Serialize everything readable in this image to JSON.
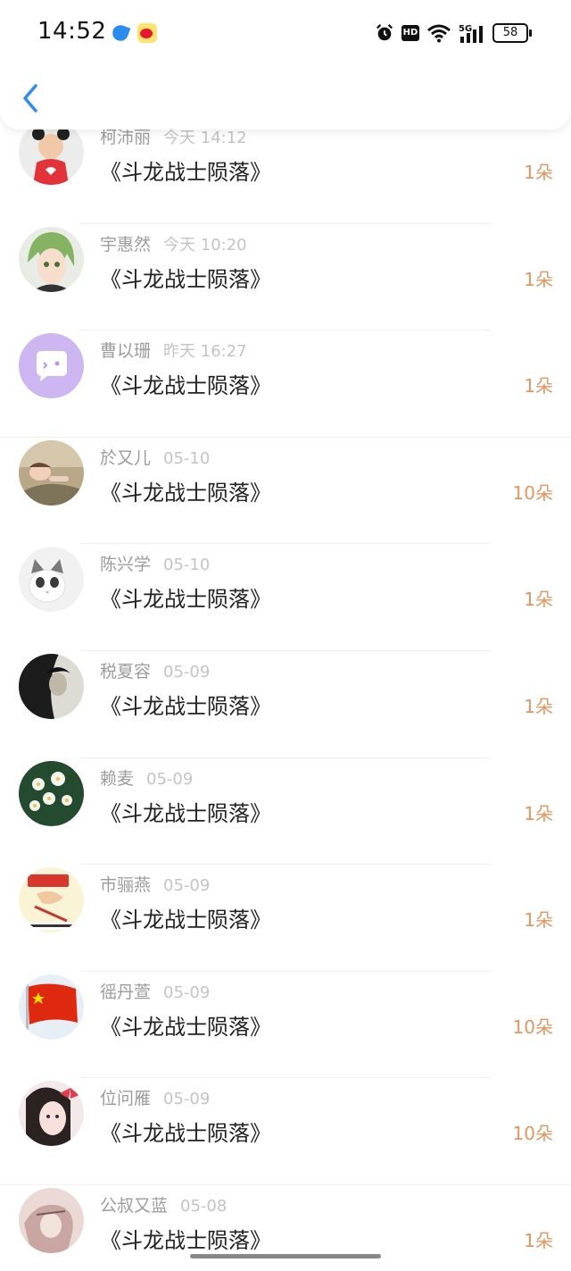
{
  "status_bar": {
    "time": "14:52",
    "battery": "58",
    "hd": "HD",
    "network": "5G"
  },
  "header": {
    "back_icon": "chevron-left-icon",
    "accent": "#2f8fe6"
  },
  "colors": {
    "name": "#9c9c9c",
    "date": "#c4c4c4",
    "title": "#222222",
    "count": "#e8945e"
  },
  "gifts": [
    {
      "name": "柯沛丽",
      "date": "今天 14:12",
      "title": "《斗龙战士陨落》",
      "count": "1朵",
      "avatar": "girl-red-avatar"
    },
    {
      "name": "宇惠然",
      "date": "今天 10:20",
      "title": "《斗龙战士陨落》",
      "count": "1朵",
      "avatar": "anime-boy-avatar"
    },
    {
      "name": "曹以珊",
      "date": "昨天 16:27",
      "title": "《斗龙战士陨落》",
      "count": "1朵",
      "avatar": "chat-bubble-avatar"
    },
    {
      "name": "於又儿",
      "date": "05-10",
      "title": "《斗龙战士陨落》",
      "count": "10朵",
      "avatar": "outdoor-girl-avatar"
    },
    {
      "name": "陈兴学",
      "date": "05-10",
      "title": "《斗龙战士陨落》",
      "count": "1朵",
      "avatar": "cat-avatar"
    },
    {
      "name": "税夏容",
      "date": "05-09",
      "title": "《斗龙战士陨落》",
      "count": "1朵",
      "avatar": "dark-portrait-avatar"
    },
    {
      "name": "赖麦",
      "date": "05-09",
      "title": "《斗龙战士陨落》",
      "count": "1朵",
      "avatar": "white-flowers-avatar"
    },
    {
      "name": "市骊燕",
      "date": "05-09",
      "title": "《斗龙战士陨落》",
      "count": "1朵",
      "avatar": "cartoon-exam-avatar"
    },
    {
      "name": "徭丹萱",
      "date": "05-09",
      "title": "《斗龙战士陨落》",
      "count": "10朵",
      "avatar": "flag-avatar"
    },
    {
      "name": "位问雁",
      "date": "05-09",
      "title": "《斗龙战士陨落》",
      "count": "10朵",
      "avatar": "girl-bow-avatar"
    },
    {
      "name": "公叔又蓝",
      "date": "05-08",
      "title": "《斗龙战士陨落》",
      "count": "1朵",
      "avatar": "sketch-avatar"
    }
  ]
}
